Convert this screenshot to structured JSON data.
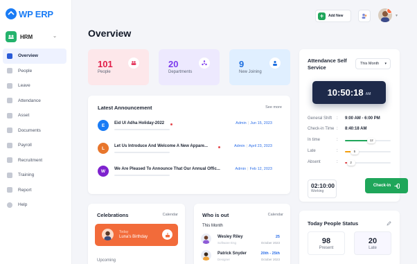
{
  "brand": {
    "logo_text": "WP ERP",
    "accent": "#1a7cf5"
  },
  "sidebar": {
    "module": "HRM",
    "items": [
      {
        "label": "Overview",
        "icon": "monitor-icon",
        "active": true
      },
      {
        "label": "People",
        "icon": "person-icon",
        "active": false
      },
      {
        "label": "Leave",
        "icon": "leave-icon",
        "active": false
      },
      {
        "label": "Attendance",
        "icon": "attendance-icon",
        "active": false
      },
      {
        "label": "Asset",
        "icon": "asset-icon",
        "active": false
      },
      {
        "label": "Documents",
        "icon": "folder-icon",
        "active": false
      },
      {
        "label": "Payroll",
        "icon": "bank-icon",
        "active": false
      },
      {
        "label": "Recruitment",
        "icon": "briefcase-icon",
        "active": false
      },
      {
        "label": "Training",
        "icon": "training-icon",
        "active": false
      },
      {
        "label": "Report",
        "icon": "report-icon",
        "active": false
      },
      {
        "label": "Help",
        "icon": "help-icon",
        "active": false
      }
    ]
  },
  "topbar": {
    "add_new": "Add New"
  },
  "page": {
    "title": "Overview"
  },
  "stats": [
    {
      "value": "101",
      "label": "People",
      "bg": "#fde7ea",
      "color": "#e11d48",
      "icon": "people-icon"
    },
    {
      "value": "20",
      "label": "Departments",
      "bg": "#ede9fe",
      "color": "#7c3aed",
      "icon": "departments-icon"
    },
    {
      "value": "9",
      "label": "New Joining",
      "bg": "#e0efff",
      "color": "#1d6fe0",
      "icon": "new-joining-icon"
    }
  ],
  "announcements": {
    "title": "Latest Announcement",
    "see_more": "See more",
    "items": [
      {
        "initial": "E",
        "color": "#1a7cf5",
        "title": "Eid Ul Adha Holiday-2022",
        "author": "Admin",
        "date": "Jun 15, 2023"
      },
      {
        "initial": "L",
        "color": "#e8762c",
        "title": "Let Us Introduce And Welcome A New Appare...",
        "author": "Admin",
        "date": "April 23, 2023"
      },
      {
        "initial": "W",
        "color": "#7e22ce",
        "title": "We Are Pleased To Announce That Our Annual Offic...",
        "author": "Admin",
        "date": "Feb 12, 2023"
      }
    ]
  },
  "attendance": {
    "title": "Attendance Self Service",
    "period": "This Month",
    "time": "10:50:18",
    "ampm": "AM",
    "shift_label": "General Shift",
    "shift_value": "9:00 AM - 6:00 PM",
    "checkin_label": "Check-in Time",
    "checkin_value": "8:40:18 AM",
    "bars": [
      {
        "label": "In time",
        "value": "12",
        "fraction": 0.55,
        "color": "#1fa65a"
      },
      {
        "label": "Late",
        "value": "5",
        "fraction": 0.18,
        "color": "#f59e0b"
      },
      {
        "label": "Absent",
        "value": "2",
        "fraction": 0.1,
        "color": "#e5484d"
      }
    ],
    "worked_time": "02:10:00",
    "worked_label": "Working",
    "checkin_button": "Check-in"
  },
  "celebrations": {
    "title": "Celebrations",
    "calendar": "Calendar",
    "today_label": "Today",
    "today_name": "Luna's Birthday",
    "upcoming": "Upcoming"
  },
  "who_is_out": {
    "title": "Who is out",
    "calendar": "Calendar",
    "period": "This Month",
    "people": [
      {
        "name": "Wesley Riley",
        "sub": "Software Eng",
        "days": "25",
        "date": "October 2023"
      },
      {
        "name": "Patrick Snyder",
        "sub": "Designer",
        "days": "20th - 25th",
        "date": "October 2023"
      }
    ]
  },
  "today_status": {
    "title": "Today People Status",
    "present": "98",
    "present_label": "Present",
    "late": "20",
    "late_label": "Late"
  }
}
